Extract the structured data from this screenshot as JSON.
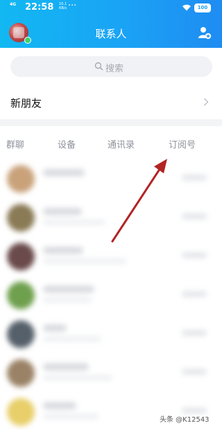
{
  "status_bar": {
    "network": "4G",
    "time": "22:58",
    "rate_value": "10.1",
    "rate_unit": "KB/s",
    "more": "···",
    "battery": "100"
  },
  "header": {
    "title": "联系人",
    "left_icon": "avatar",
    "right_icon": "add-friend-icon",
    "gradient_start": "#12b8f2",
    "gradient_end": "#1f8cf2"
  },
  "search": {
    "placeholder": "搜索",
    "icon": "search-icon"
  },
  "new_friends": {
    "label": "新朋友",
    "icon": "chevron-right-icon"
  },
  "tabs": [
    {
      "label": "群聊"
    },
    {
      "label": "设备"
    },
    {
      "label": "通讯录"
    },
    {
      "label": "订阅号"
    }
  ],
  "annotation": {
    "arrow_color": "#b32424",
    "points_to": "订阅号"
  },
  "watermark": "头条 @K12543"
}
